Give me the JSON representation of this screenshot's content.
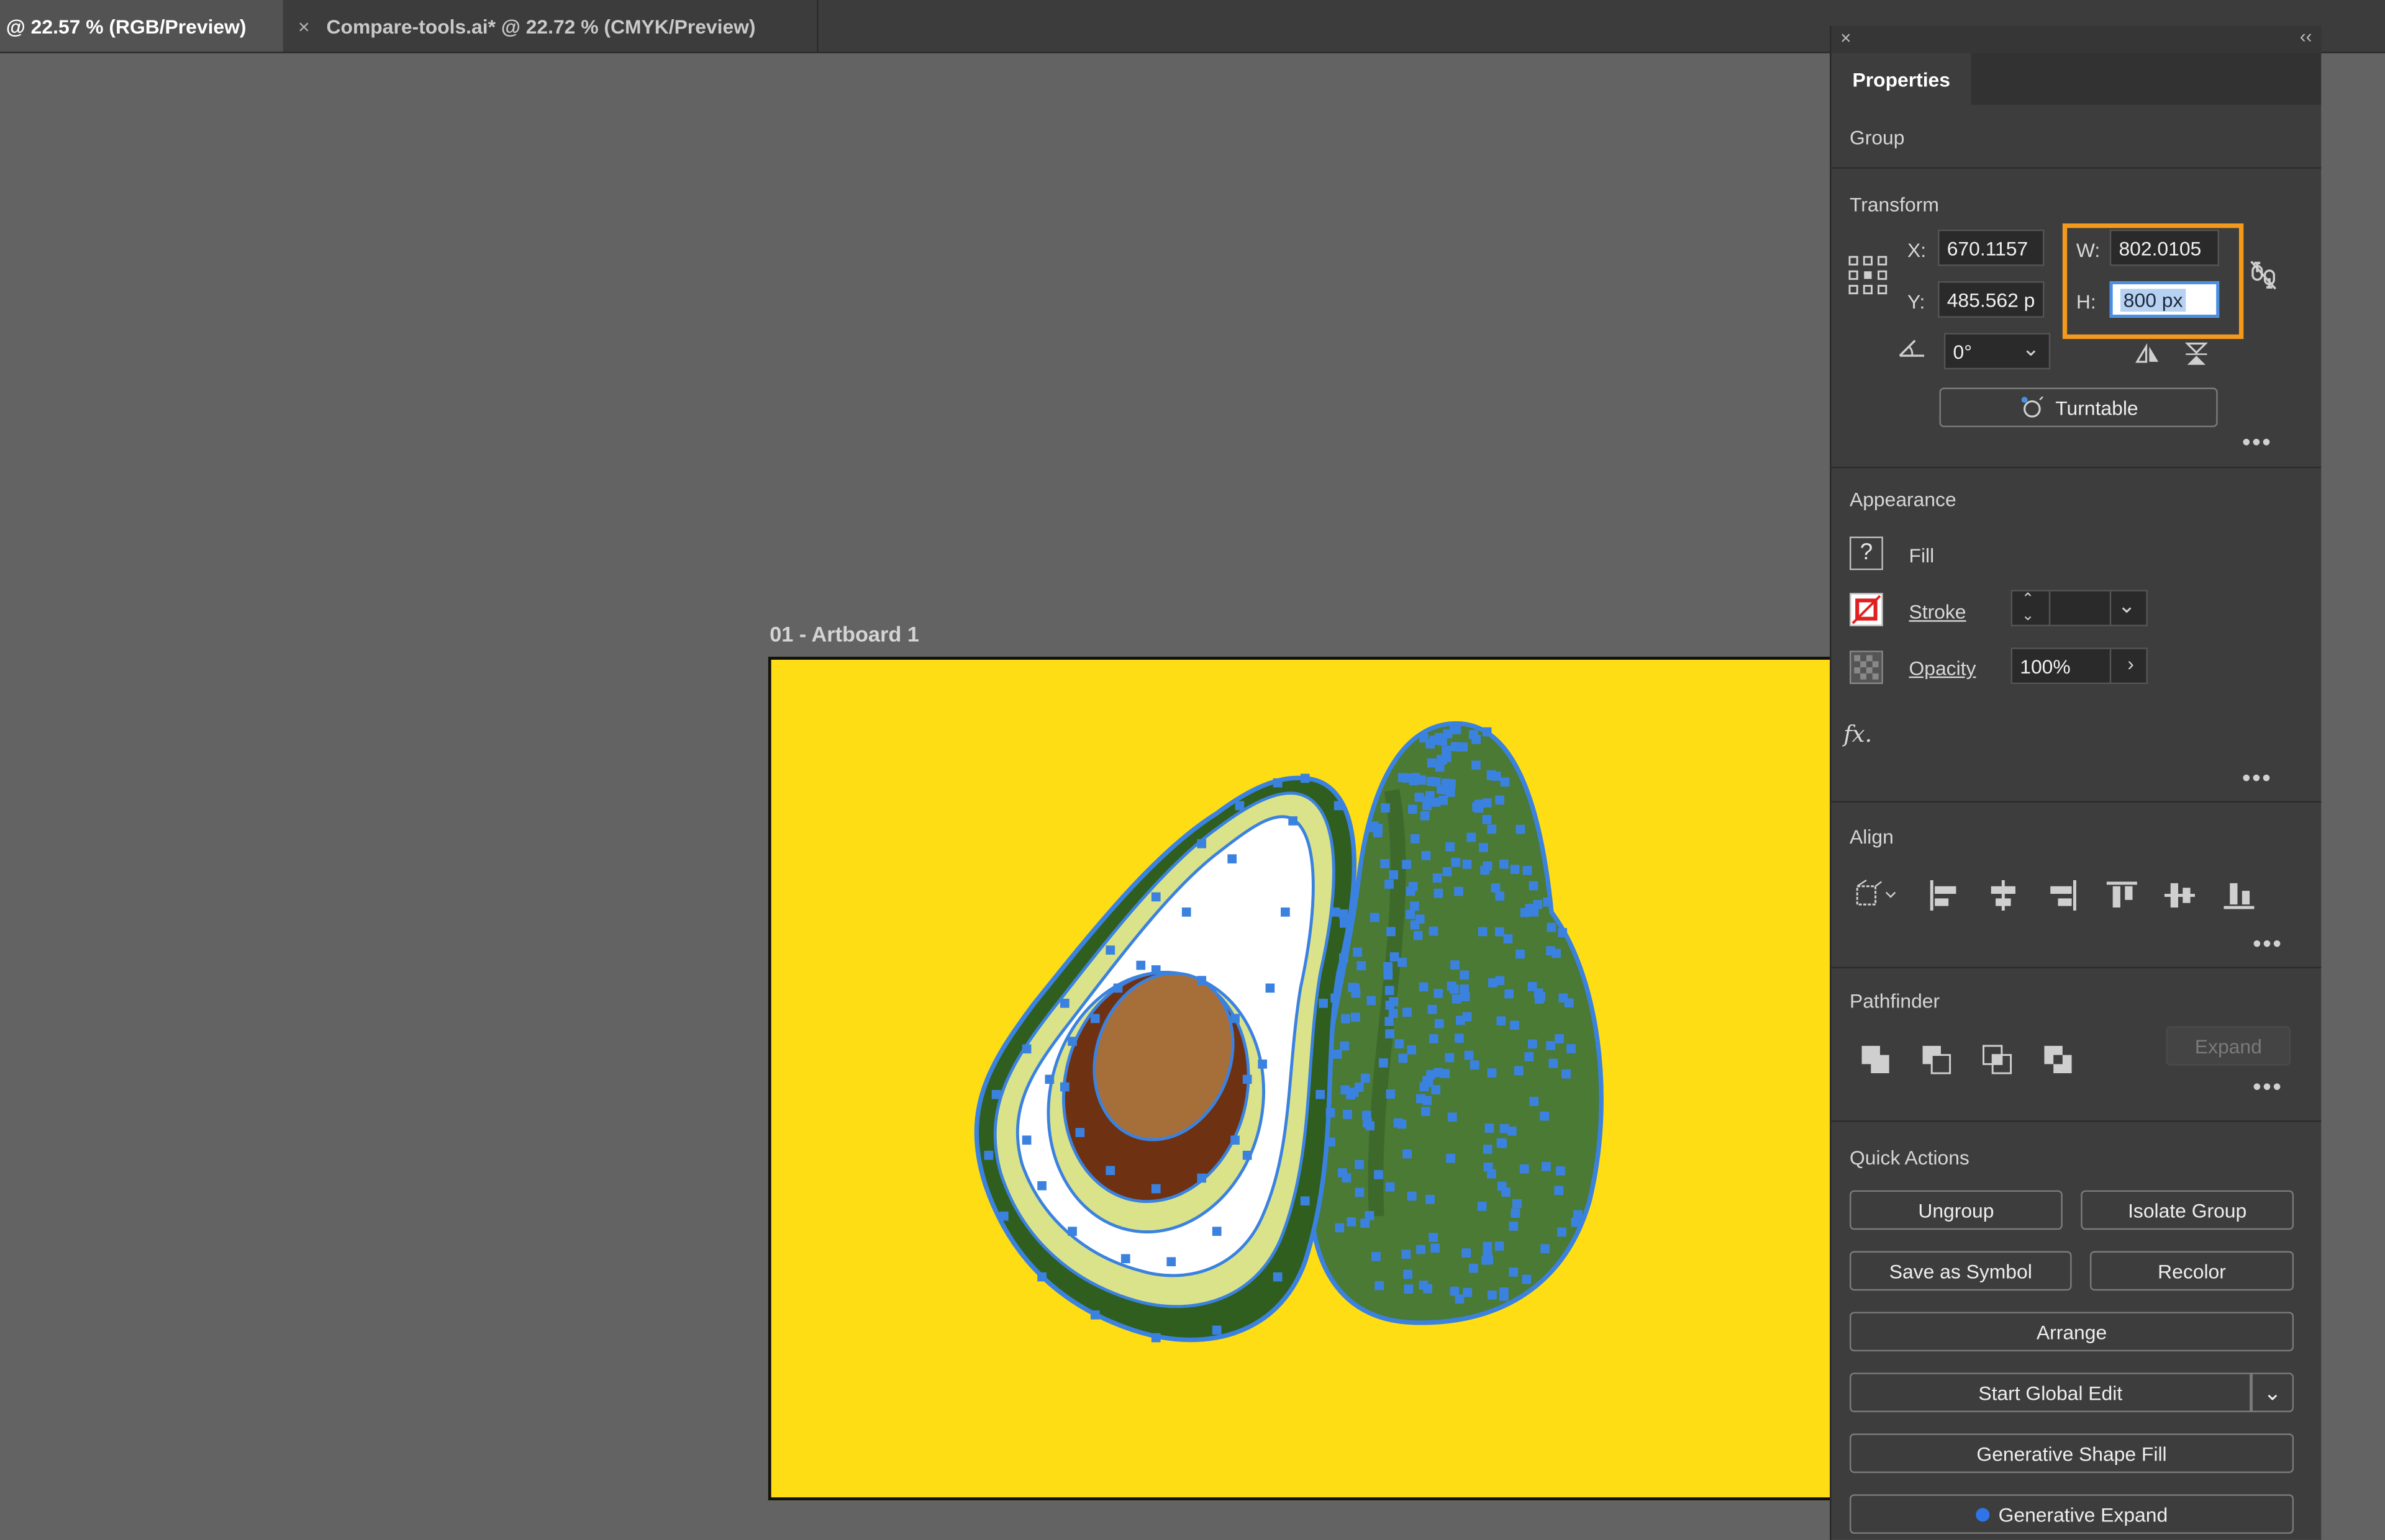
{
  "tabs": [
    {
      "label": "@ 22.57 % (RGB/Preview)",
      "active": true
    },
    {
      "label": "Compare-tools.ai* @ 22.72 % (CMYK/Preview)",
      "close": "×"
    }
  ],
  "canvas": {
    "artboard_label": "01 - Artboard 1",
    "artboard_color": "#ffdd15"
  },
  "panel": {
    "close": "×",
    "collapse": "‹‹",
    "tab": "Properties",
    "selection_type": "Group",
    "transform": {
      "title": "Transform",
      "x_label": "X:",
      "x_value": "670.1157",
      "y_label": "Y:",
      "y_value": "485.562 p",
      "w_label": "W:",
      "w_value": "802.0105",
      "h_label": "H:",
      "h_value": "800 px",
      "angle_value": "0°",
      "turntable": "Turntable",
      "highlight_color": "#f39a1d"
    },
    "appearance": {
      "title": "Appearance",
      "fill": "Fill",
      "stroke": "Stroke",
      "opacity": "Opacity",
      "opacity_value": "100%",
      "fx": "fx."
    },
    "align": {
      "title": "Align"
    },
    "pathfinder": {
      "title": "Pathfinder",
      "expand": "Expand"
    },
    "quick_actions": {
      "title": "Quick Actions",
      "ungroup": "Ungroup",
      "isolate_group": "Isolate Group",
      "save_as_symbol": "Save as Symbol",
      "recolor": "Recolor",
      "arrange": "Arrange",
      "start_global_edit": "Start Global Edit",
      "generative_shape_fill": "Generative Shape Fill",
      "generative_expand": "Generative Expand"
    },
    "more": "•••"
  }
}
